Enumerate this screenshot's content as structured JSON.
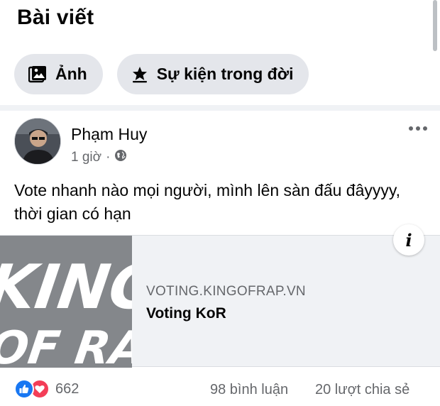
{
  "section": {
    "title": "Bài viết"
  },
  "chips": [
    {
      "label": "Ảnh",
      "icon": "photo-icon"
    },
    {
      "label": "Sự kiện trong đời",
      "icon": "star-flag-icon"
    }
  ],
  "post": {
    "author": "Phạm Huy",
    "time": "1 giờ",
    "separator": "·",
    "privacy_icon": "globe-icon",
    "text": "Vote nhanh nào mọi người, mình lên sàn đấu đâyyyy, thời gian có hạn",
    "link": {
      "domain": "VOTING.KINGOFRAP.VN",
      "title": "Voting KoR",
      "thumbnail_text": [
        "KING",
        "OF RAP"
      ],
      "info": "i"
    },
    "reactions": {
      "count": "662",
      "types": [
        "like-icon",
        "love-icon"
      ]
    },
    "comments": "98 bình luận",
    "shares": "20 lượt chia sẻ"
  },
  "colors": {
    "text": "#050505",
    "secondary": "#65676b",
    "chip_bg": "#e4e6eb",
    "like": "#1877f2",
    "love": "#f33e58"
  }
}
